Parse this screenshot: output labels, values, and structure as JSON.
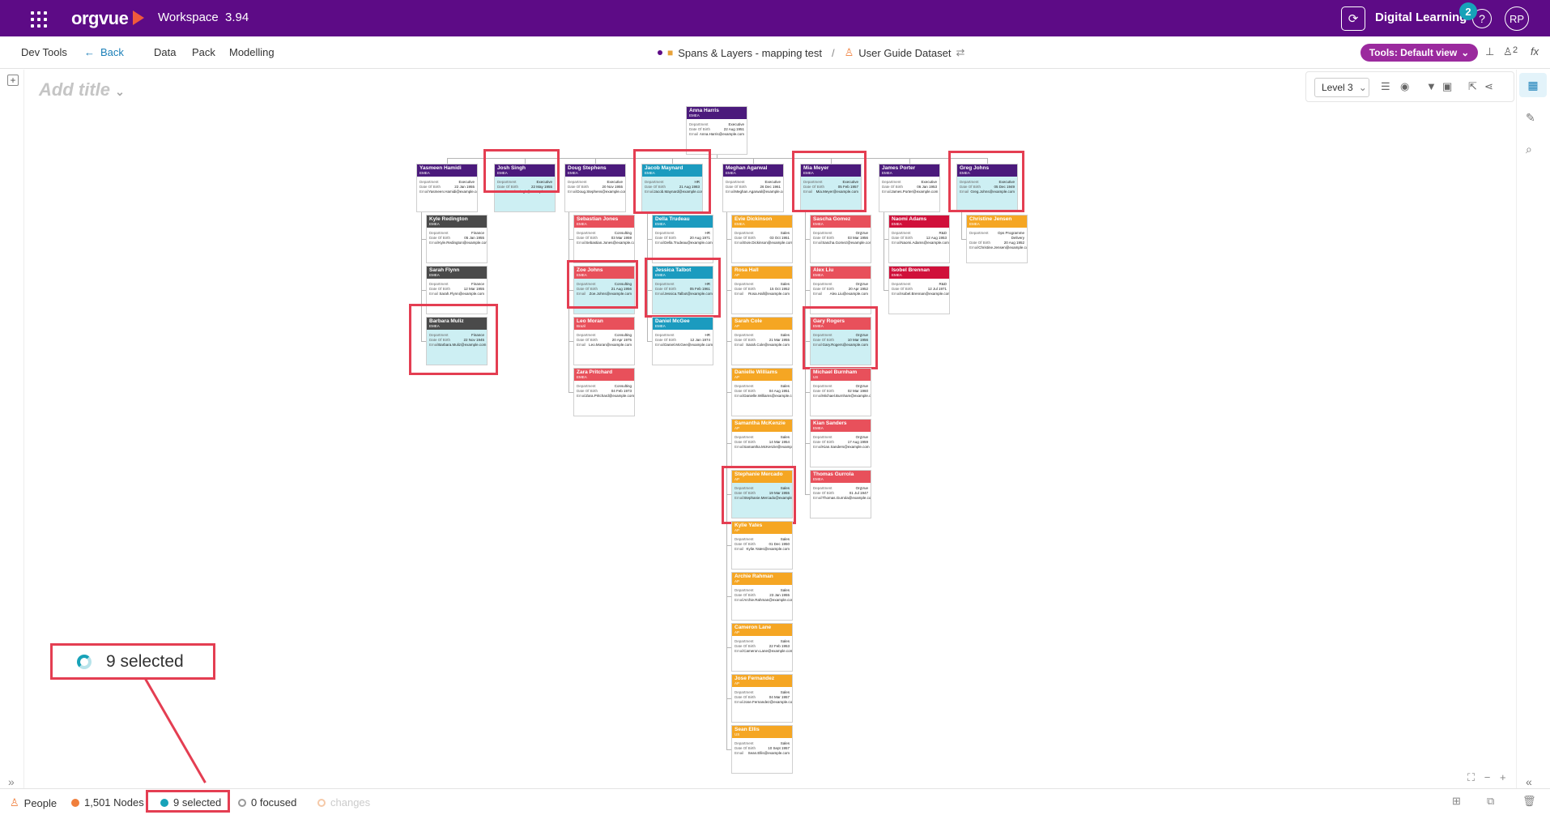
{
  "header": {
    "logo": "orgvue",
    "workspace": "Workspace",
    "version": "3.94",
    "org": "Digital Learning",
    "notifications": "2",
    "help": "?",
    "user_initials": "RP"
  },
  "menu": {
    "items": [
      "Dev Tools",
      "Back",
      "Data",
      "Pack",
      "Modelling"
    ],
    "breadcrumb": {
      "project": "Spans & Layers - mapping test",
      "separator": "/",
      "dataset": "User Guide Dataset"
    },
    "tools_button": "Tools: Default view",
    "collaborators": "2",
    "fx": "fx"
  },
  "canvas": {
    "add_title": "Add title",
    "level": "Level 3"
  },
  "cards": [
    {
      "id": "anna",
      "name": "Anna Harris",
      "region": "EMEA",
      "dept": "Executive",
      "dob": "22 Aug 1951",
      "email": "Anna.Harris@example.com",
      "color": "#4b1a7c",
      "selected": false
    },
    {
      "id": "yasmeen",
      "name": "Yasmeen Hamidi",
      "region": "EMEA",
      "dept": "Executive",
      "dob": "22 Jan 1955",
      "email": "Yasmeen.Hamidi@example.com",
      "color": "#4b1a7c",
      "selected": false
    },
    {
      "id": "josh",
      "name": "Josh Singh",
      "region": "EMEA",
      "dept": "Executive",
      "dob": "22 May 1955",
      "email": "Josh.Singh@example.com",
      "color": "#4b1a7c",
      "selected": true
    },
    {
      "id": "doug",
      "name": "Doug Stephens",
      "region": "EMEA",
      "dept": "Executive",
      "dob": "20 Nov 1955",
      "email": "Doug.Stephens@example.com",
      "color": "#4b1a7c",
      "selected": false
    },
    {
      "id": "jacob",
      "name": "Jacob Maynard",
      "region": "EMEA",
      "dept": "HR",
      "dob": "21 Aug 1983",
      "email": "Jacob.Maynard@example.com",
      "color": "#1b9bbf",
      "selected": true
    },
    {
      "id": "meghan",
      "name": "Meghan Agarwal",
      "region": "EMEA",
      "dept": "Executive",
      "dob": "26 Dec 1961",
      "email": "Meghan.Agarwal@example.com",
      "color": "#4b1a7c",
      "selected": false
    },
    {
      "id": "mia",
      "name": "Mia Meyer",
      "region": "EMEA",
      "dept": "Executive",
      "dob": "05 Feb 1957",
      "email": "Mia.Meyer@example.com",
      "color": "#4b1a7c",
      "selected": true
    },
    {
      "id": "james",
      "name": "James Porter",
      "region": "EMEA",
      "dept": "Executive",
      "dob": "06 Jan 1953",
      "email": "James.Porter@example.com",
      "color": "#4b1a7c",
      "selected": false
    },
    {
      "id": "greg",
      "name": "Greg Johns",
      "region": "EMEA",
      "dept": "Executive",
      "dob": "05 Dec 1949",
      "email": "Greg.Johns@example.com",
      "color": "#4b1a7c",
      "selected": true
    },
    {
      "id": "kyle",
      "name": "Kyle Redington",
      "region": "EMEA",
      "dept": "Finance",
      "dob": "05 Jan 1955",
      "email": "Kyle.Redington@example.com",
      "color": "#4a4a4a",
      "selected": false
    },
    {
      "id": "sarah",
      "name": "Sarah Flynn",
      "region": "EMEA",
      "dept": "Finance",
      "dob": "12 Mar 1955",
      "email": "Sarah.Flynn@example.com",
      "color": "#4a4a4a",
      "selected": false
    },
    {
      "id": "barbara",
      "name": "Barbara Muliz",
      "region": "EMEA",
      "dept": "Finance",
      "dob": "22 Nov 1945",
      "email": "Barbara.Muliz@example.com",
      "color": "#4a4a4a",
      "selected": true
    },
    {
      "id": "sebastian",
      "name": "Sebastian Jones",
      "region": "EMEA",
      "dept": "Consulting",
      "dob": "03 Mar 1959",
      "email": "Sebastian.Jones@example.com",
      "color": "#e8505b",
      "selected": false
    },
    {
      "id": "zoe",
      "name": "Zoe Johns",
      "region": "EMEA",
      "dept": "Consulting",
      "dob": "21 Aug 1956",
      "email": "Zoe.Johns@example.com",
      "color": "#e8505b",
      "selected": true
    },
    {
      "id": "leo",
      "name": "Leo Moran",
      "region": "Brazil",
      "dept": "Consulting",
      "dob": "20 Apr 1975",
      "email": "Leo.Moran@example.com",
      "color": "#e8505b",
      "selected": false
    },
    {
      "id": "zara",
      "name": "Zara Pritchard",
      "region": "EMEA",
      "dept": "Consulting",
      "dob": "04 Feb 1973",
      "email": "Zara.Pritchard@example.com",
      "color": "#e8505b",
      "selected": false
    },
    {
      "id": "della",
      "name": "Della Trudeau",
      "region": "EMEA",
      "dept": "HR",
      "dob": "20 Aug 1971",
      "email": "Della.Trudeau@example.com",
      "color": "#1b9bbf",
      "selected": false
    },
    {
      "id": "jessica",
      "name": "Jessica Talbot",
      "region": "EMEA",
      "dept": "HR",
      "dob": "05 Feb 1961",
      "email": "Jessica.Talbot@example.com",
      "color": "#1b9bbf",
      "selected": true
    },
    {
      "id": "daniel",
      "name": "Daniel McGee",
      "region": "EMEA",
      "dept": "HR",
      "dob": "12 Jan 1974",
      "email": "Daniel.McGee@example.com",
      "color": "#1b9bbf",
      "selected": false
    },
    {
      "id": "evie",
      "name": "Evie Dickinson",
      "region": "EMEA",
      "dept": "Sales",
      "dob": "03 Oct 1951",
      "email": "Evie.Dickinson@example.com",
      "color": "#f5a623",
      "selected": false
    },
    {
      "id": "rosa",
      "name": "Rosa Hall",
      "region": "AP",
      "dept": "Sales",
      "dob": "15 Oct 1952",
      "email": "Rosa.Hall@example.com",
      "color": "#f5a623",
      "selected": false
    },
    {
      "id": "sarahc",
      "name": "Sarah Cole",
      "region": "AP",
      "dept": "Sales",
      "dob": "21 Mar 1955",
      "email": "Sarah.Cole@example.com",
      "color": "#f5a623",
      "selected": false
    },
    {
      "id": "danielle",
      "name": "Danielle Williams",
      "region": "AP",
      "dept": "Sales",
      "dob": "04 Aug 1951",
      "email": "Danielle.Williams@example.com",
      "color": "#f5a623",
      "selected": false
    },
    {
      "id": "samantha",
      "name": "Samantha McKenzie",
      "region": "AP",
      "dept": "Sales",
      "dob": "14 Mar 1954",
      "email": "Samantha.McKenzie@example.com",
      "color": "#f5a623",
      "selected": false
    },
    {
      "id": "stephanie",
      "name": "Stephanie Mercado",
      "region": "AP",
      "dept": "Sales",
      "dob": "19 Mar 1955",
      "email": "Stephanie.Mercado@example.com",
      "color": "#f5a623",
      "selected": true
    },
    {
      "id": "kyliey",
      "name": "Kylie Yates",
      "region": "AP",
      "dept": "Sales",
      "dob": "01 Dec 1950",
      "email": "Kylie.Yates@example.com",
      "color": "#f5a623",
      "selected": false
    },
    {
      "id": "archie",
      "name": "Archie Rahman",
      "region": "AP",
      "dept": "Sales",
      "dob": "23 Jan 1955",
      "email": "Archie.Rahman@example.com",
      "color": "#f5a623",
      "selected": false
    },
    {
      "id": "cameron",
      "name": "Cameron Lane",
      "region": "AP",
      "dept": "Sales",
      "dob": "22 Feb 1953",
      "email": "Cameron.Lane@example.com",
      "color": "#f5a623",
      "selected": false
    },
    {
      "id": "jose",
      "name": "Jose Fernandez",
      "region": "AP",
      "dept": "Sales",
      "dob": "04 Mar 1957",
      "email": "Jose.Fernandez@example.com",
      "color": "#f5a623",
      "selected": false
    },
    {
      "id": "sean",
      "name": "Sean Ellis",
      "region": "US",
      "dept": "Sales",
      "dob": "10 Sept 1957",
      "email": "Sean.Ellis@example.com",
      "color": "#f5a623",
      "selected": false
    },
    {
      "id": "sasha",
      "name": "Sascha Gomez",
      "region": "EMEA",
      "dept": "OrgVue",
      "dob": "03 Mar 1956",
      "email": "Sascha.Gomez@example.com",
      "color": "#e8505b",
      "selected": false
    },
    {
      "id": "alex",
      "name": "Alex Liu",
      "region": "EMEA",
      "dept": "OrgVue",
      "dob": "20 Apr 1952",
      "email": "Alex.Liu@example.com",
      "color": "#e8505b",
      "selected": false
    },
    {
      "id": "gary",
      "name": "Gary Rogers",
      "region": "EMEA",
      "dept": "OrgVue",
      "dob": "10 Mar 1956",
      "email": "Gary.Rogers@example.com",
      "color": "#e8505b",
      "selected": true
    },
    {
      "id": "michael",
      "name": "Michael Burnham",
      "region": "US",
      "dept": "OrgVue",
      "dob": "02 Mar 1960",
      "email": "Michael.Burnham@example.com",
      "color": "#e8505b",
      "selected": false
    },
    {
      "id": "kian",
      "name": "Kian Sanders",
      "region": "EMEA",
      "dept": "OrgVue",
      "dob": "17 Aug 1959",
      "email": "Kian.Sanders@example.com",
      "color": "#e8505b",
      "selected": false
    },
    {
      "id": "thomas",
      "name": "Thomas Gurrola",
      "region": "EMEA",
      "dept": "OrgVue",
      "dob": "01 Jul 1947",
      "email": "Thomas.Gurrola@example.com",
      "color": "#e8505b",
      "selected": false
    },
    {
      "id": "naomi",
      "name": "Naomi Adams",
      "region": "EMEA",
      "dept": "R&D",
      "dob": "12 Aug 1953",
      "email": "Naomi.Adams@example.com",
      "color": "#d0103a",
      "selected": false
    },
    {
      "id": "isobel",
      "name": "Isobel Brennan",
      "region": "EMEA",
      "dept": "R&D",
      "dob": "12 Jul 1971",
      "email": "Isobel.Brennan@example.com",
      "color": "#d0103a",
      "selected": false
    },
    {
      "id": "christine",
      "name": "Christine Jensen",
      "region": "EMEA",
      "dept": "Ops Programme Delivery",
      "dob": "20 Aug 1952",
      "email": "Christine.Jensen@example.com",
      "color": "#f5a623",
      "selected": false
    }
  ],
  "card_labels": {
    "dept": "Department",
    "dob": "Date Of Birth",
    "email": "Email"
  },
  "callout": {
    "text": "9 selected"
  },
  "status": {
    "people": "People",
    "nodes": "1,501 Nodes",
    "selected": "9 selected",
    "focused": "0 focused",
    "changes": "changes"
  },
  "colors": {
    "brand": "#5d0b86",
    "highlight": "#e43e52",
    "accent": "#17a2b8",
    "tools": "#9b2a9e"
  }
}
